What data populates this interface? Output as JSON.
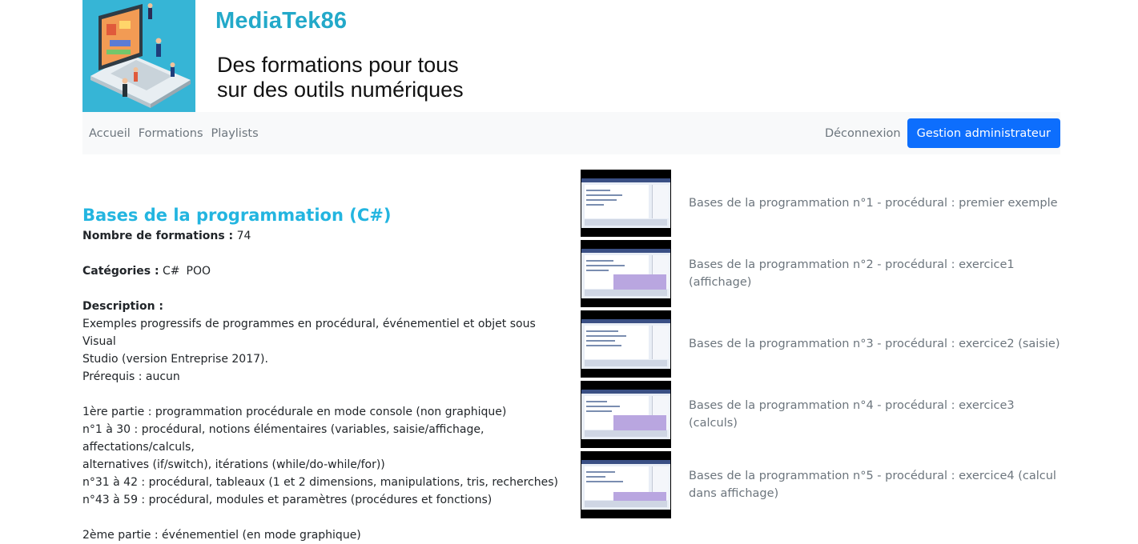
{
  "header": {
    "site_name": "MediaTek86",
    "tagline_line1": "Des formations pour tous",
    "tagline_line2": "sur des outils numériques"
  },
  "nav": {
    "items": [
      "Accueil",
      "Formations",
      "Playlists"
    ],
    "logout": "Déconnexion",
    "admin_button": "Gestion administrateur"
  },
  "playlist": {
    "title": "Bases de la programmation (C#)",
    "count_label": "Nombre de formations :",
    "count": "74",
    "categories_label": "Catégories :",
    "categories": [
      "C#",
      "POO"
    ],
    "description_label": "Description :",
    "description_lines": [
      "Exemples progressifs de programmes en procédural, événementiel et objet sous Visual",
      "Studio (version Entreprise 2017).",
      "Prérequis : aucun",
      "",
      "1ère partie : programmation procédurale en mode console (non graphique)",
      "n°1 à 30 : procédural, notions élémentaires (variables, saisie/affichage, affectations/calculs,",
      "alternatives (if/switch), itérations (while/do-while/for))",
      "n°31 à 42 : procédural, tableaux (1 et 2 dimensions, manipulations, tris, recherches)",
      "n°43 à 59 : procédural, modules et paramètres (procédures et fonctions)",
      "",
      "2ème partie : événementiel (en mode graphique)"
    ]
  },
  "formations": [
    {
      "title": "Bases de la programmation n°1 - procédural : premier exemple",
      "popup": false
    },
    {
      "title": "Bases de la programmation n°2 - procédural : exercice1 (affichage)",
      "popup": true
    },
    {
      "title": "Bases de la programmation n°3 - procédural : exercice2 (saisie)",
      "popup": false
    },
    {
      "title": "Bases de la programmation n°4 - procédural : exercice3 (calculs)",
      "popup": true
    },
    {
      "title": "Bases de la programmation n°5 - procédural : exercice4 (calcul dans affichage)",
      "popup": true
    }
  ],
  "colors": {
    "brand_title": "#23a9c9",
    "playlist_title": "#23b5e0",
    "primary_button": "#0d6efd",
    "logo_background": "#36b5d6"
  }
}
